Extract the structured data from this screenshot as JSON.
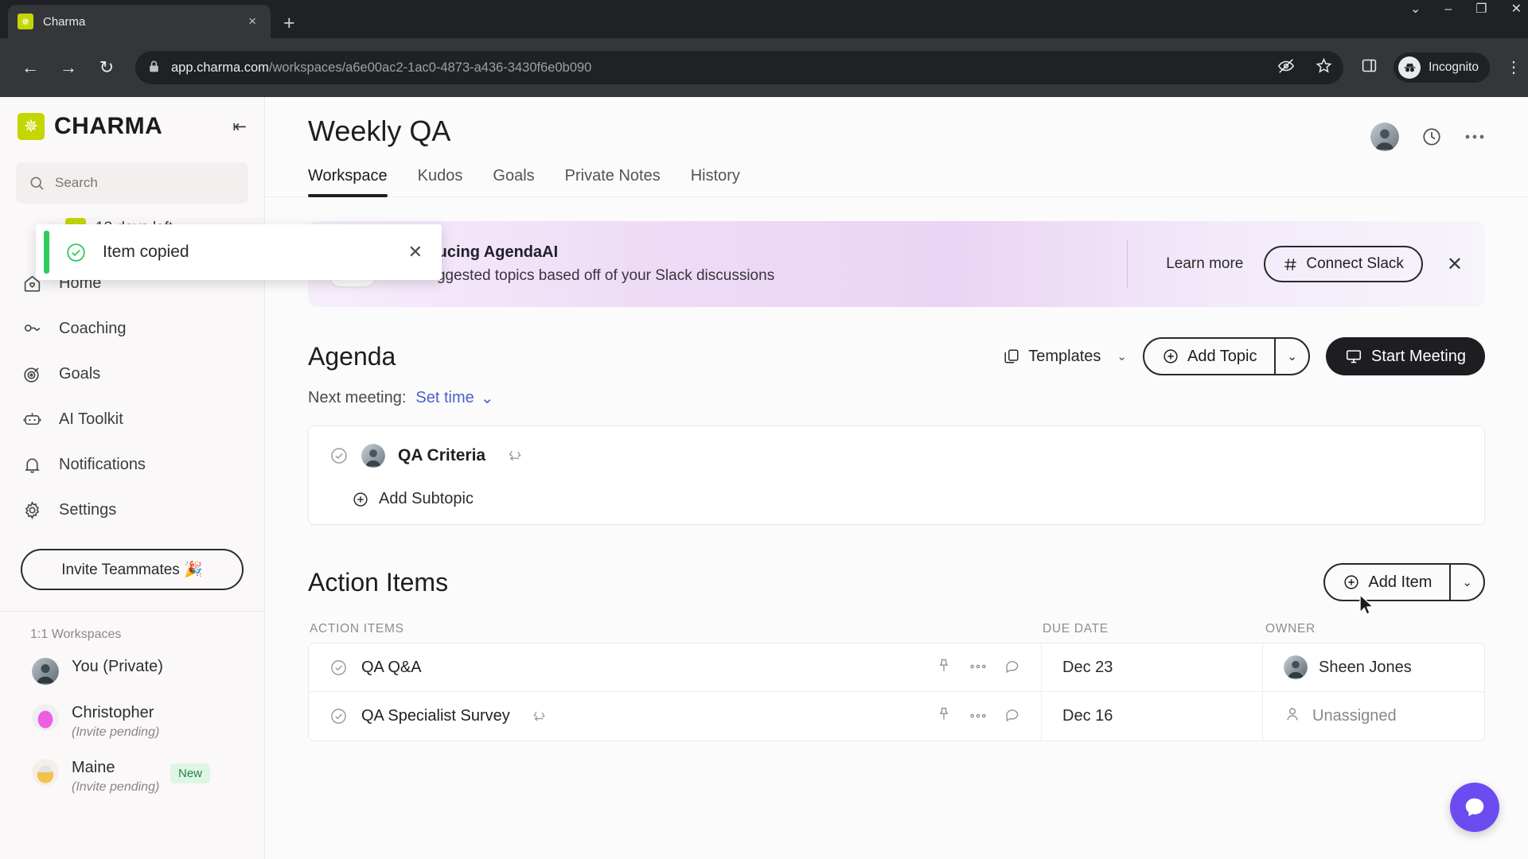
{
  "browser": {
    "tab": {
      "title": "Charma",
      "favicon": "charma-logo-icon",
      "close_label": "×"
    },
    "new_tab_label": "+",
    "window_controls": {
      "minimize": "–",
      "maximize": "❐",
      "close": "✕",
      "expand": "⌄"
    },
    "nav": {
      "back": "←",
      "forward": "→",
      "reload": "↻"
    },
    "address": {
      "lock_icon": "lock-icon",
      "domain": "app.charma.com",
      "path": "/workspaces/a6e00ac2-1ac0-4873-a436-3430f6e0b090"
    },
    "profile_label": "Incognito",
    "menu_icon": "kebab-menu-icon"
  },
  "sidebar": {
    "logo_text": "CHARMA",
    "collapse_label": "⇤",
    "search_placeholder": "Search",
    "trial": {
      "label": "13 days left"
    },
    "nav_items": [
      {
        "label": "Home",
        "icon": "home-icon"
      },
      {
        "label": "Coaching",
        "icon": "coaching-icon"
      },
      {
        "label": "Goals",
        "icon": "goals-target-icon"
      },
      {
        "label": "AI Toolkit",
        "icon": "robot-icon"
      },
      {
        "label": "Notifications",
        "icon": "bell-icon"
      },
      {
        "label": "Settings",
        "icon": "gear-icon"
      }
    ],
    "invite_button": "Invite Teammates 🎉",
    "section_label": "1:1 Workspaces",
    "workspaces": [
      {
        "name": "You (Private)",
        "sub": "",
        "badge": ""
      },
      {
        "name": "Christopher",
        "sub": "(Invite pending)",
        "badge": ""
      },
      {
        "name": "Maine",
        "sub": "(Invite pending)",
        "badge": "New"
      }
    ]
  },
  "toast": {
    "message": "Item copied",
    "icon": "check-circle-icon",
    "close_label": "✕",
    "accent_color": "#2ecc5a"
  },
  "main": {
    "title": "Weekly QA",
    "header_icons": [
      "avatar",
      "clock-icon",
      "more-horizontal-icon"
    ],
    "tabs": [
      {
        "label": "Workspace",
        "active": true
      },
      {
        "label": "Kudos",
        "active": false
      },
      {
        "label": "Goals",
        "active": false
      },
      {
        "label": "Private Notes",
        "active": false
      },
      {
        "label": "History",
        "active": false
      }
    ],
    "promo": {
      "icon": "slack-icon",
      "title": "Introducing AgendaAI",
      "subtitle": "Get suggested topics based off of your Slack discussions",
      "learn_more": "Learn more",
      "connect_button": "Connect Slack",
      "close_label": "✕"
    },
    "agenda": {
      "heading": "Agenda",
      "templates_label": "Templates",
      "templates_caret": "⌄",
      "add_topic_label": "Add Topic",
      "add_topic_caret": "⌄",
      "start_meeting_label": "Start Meeting",
      "next_meeting_label": "Next meeting:",
      "set_time_label": "Set time",
      "set_time_caret": "⌄",
      "topics": [
        {
          "title": "QA Criteria",
          "has_recycle": true,
          "add_subtopic_label": "Add Subtopic"
        }
      ]
    },
    "action_items": {
      "heading": "Action Items",
      "add_item_label": "Add Item",
      "add_item_caret": "⌄",
      "columns": [
        "ACTION ITEMS",
        "DUE DATE",
        "OWNER"
      ],
      "rows": [
        {
          "name": "QA Q&A",
          "has_recycle": false,
          "due": "Dec 23",
          "owner": "Sheen Jones",
          "owner_assigned": true
        },
        {
          "name": "QA Specialist Survey",
          "has_recycle": true,
          "due": "Dec 16",
          "owner": "Unassigned",
          "owner_assigned": false
        }
      ]
    },
    "intercom": {
      "icon": "chat-bubble-icon",
      "color": "#6c4cf1"
    }
  }
}
